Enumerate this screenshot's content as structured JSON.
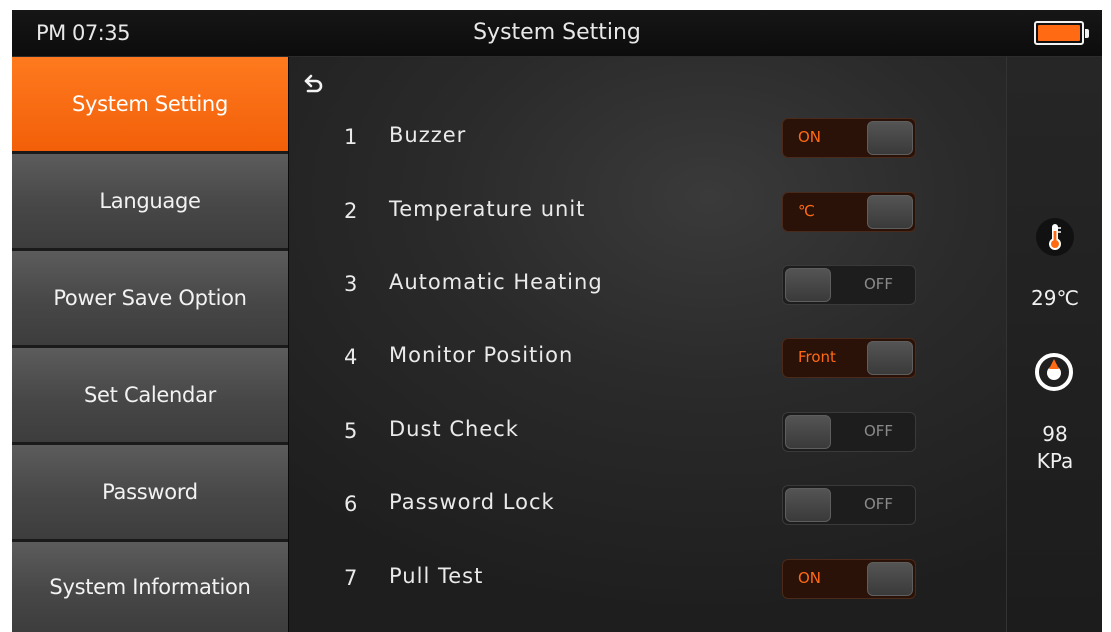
{
  "status_bar": {
    "time": "PM 07:35",
    "title": "System Setting",
    "battery_icon": "battery-icon",
    "battery_color": "#ff6a13"
  },
  "sidebar": {
    "items": [
      {
        "label": "System Setting",
        "active": true
      },
      {
        "label": "Language",
        "active": false
      },
      {
        "label": "Power Save Option",
        "active": false
      },
      {
        "label": "Set Calendar",
        "active": false
      },
      {
        "label": "Password",
        "active": false
      },
      {
        "label": "System Information",
        "active": false
      }
    ]
  },
  "main": {
    "back_icon": "back-arrow-icon",
    "settings": [
      {
        "num": "1",
        "label": "Buzzer",
        "value": "ON",
        "state": "on"
      },
      {
        "num": "2",
        "label": "Temperature unit",
        "value": "℃",
        "state": "on"
      },
      {
        "num": "3",
        "label": "Automatic Heating",
        "value": "OFF",
        "state": "off"
      },
      {
        "num": "4",
        "label": "Monitor Position",
        "value": "Front",
        "state": "on"
      },
      {
        "num": "5",
        "label": "Dust Check",
        "value": "OFF",
        "state": "off"
      },
      {
        "num": "6",
        "label": "Password Lock",
        "value": "OFF",
        "state": "off"
      },
      {
        "num": "7",
        "label": "Pull Test",
        "value": "ON",
        "state": "on"
      }
    ]
  },
  "status_panel": {
    "thermometer_icon": "thermometer-icon",
    "temperature": "29℃",
    "gauge_icon": "pressure-gauge-icon",
    "pressure_value": "98",
    "pressure_unit": "KPa"
  },
  "colors": {
    "accent": "#ff6a13",
    "panel_bg": "#2a2a2a",
    "sidebar_bg": "#4a4a4a"
  }
}
